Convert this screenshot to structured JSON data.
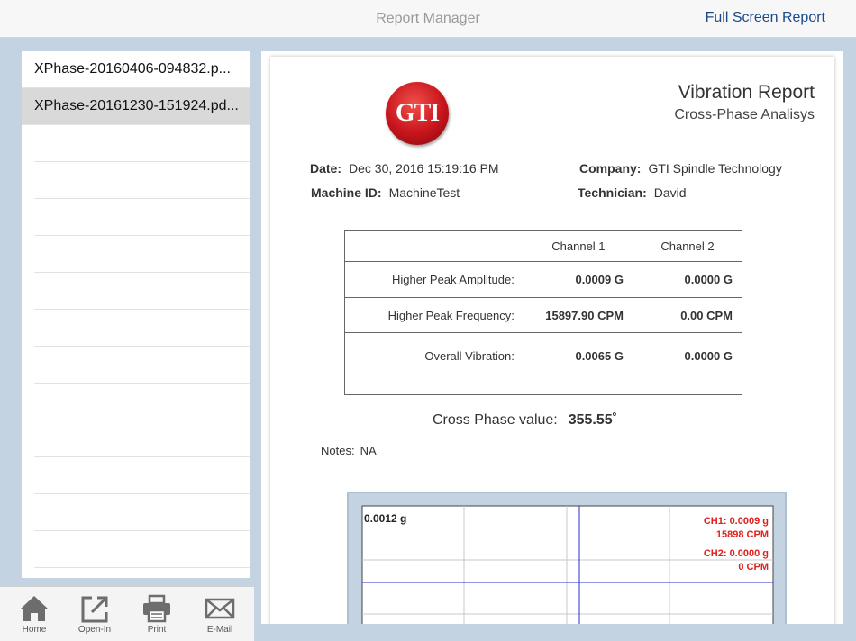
{
  "header": {
    "title": "Report Manager",
    "full_screen_label": "Full Screen Report"
  },
  "files": [
    {
      "name": "XPhase-20160406-094832.p...",
      "selected": false
    },
    {
      "name": "XPhase-20161230-151924.pd...",
      "selected": true
    }
  ],
  "toolbar": [
    {
      "label": "Home",
      "icon": "home-icon"
    },
    {
      "label": "Open-In",
      "icon": "open-in-icon"
    },
    {
      "label": "Print",
      "icon": "printer-icon"
    },
    {
      "label": "E-Mail",
      "icon": "mail-icon"
    }
  ],
  "report": {
    "logo_text": "GTI",
    "title": "Vibration Report",
    "subtitle": "Cross-Phase Analisys",
    "date_label": "Date:",
    "date_value": "Dec 30, 2016  15:19:16 PM",
    "company_label": "Company:",
    "company_value": "GTI Spindle Technology",
    "machine_label": "Machine ID:",
    "machine_value": "MachineTest",
    "technician_label": "Technician:",
    "technician_value": "David",
    "table": {
      "headers": [
        "",
        "Channel 1",
        "Channel 2"
      ],
      "rows": [
        [
          "Higher Peak Amplitude:",
          "0.0009 G",
          "0.0000 G"
        ],
        [
          "Higher Peak Frequency:",
          "15897.90 CPM",
          "0.00 CPM"
        ],
        [
          "Overall Vibration:",
          "0.0065 G",
          "0.0000 G"
        ]
      ]
    },
    "cross_phase_label": "Cross Phase value:",
    "cross_phase_value": "355.55˚",
    "notes_label": "Notes:",
    "notes_value": "NA",
    "chart": {
      "y_max_label": "0.0012 g",
      "ch1_amp": "CH1: 0.0009 g",
      "ch1_freq": "15898 CPM",
      "ch2_amp": "CH2: 0.0000 g",
      "ch2_freq": "0 CPM",
      "annotation_color": "#e0201c",
      "cursor_color": "#2a2ad0"
    }
  }
}
